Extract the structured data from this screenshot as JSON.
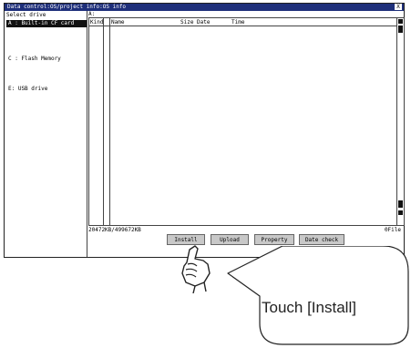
{
  "window": {
    "title": "Data control:OS/project info:OS info",
    "close_glyph": "X"
  },
  "left_panel": {
    "label": "Select drive",
    "drives": [
      {
        "label": "A : Built-in CF card",
        "selected": true
      },
      {
        "label": "C : Flash Memory",
        "selected": false
      },
      {
        "label": "E: USB drive",
        "selected": false
      }
    ]
  },
  "file_list": {
    "path": "A:",
    "columns": [
      "Kind",
      "Name",
      "Size",
      "Date",
      "Time"
    ],
    "rows": []
  },
  "status": {
    "capacity": "20472KB/499672KB",
    "file_count": "0File"
  },
  "buttons": {
    "install": "Install",
    "upload": "Upload",
    "property": "Property",
    "date_check": "Date check"
  },
  "callout": {
    "text": "Touch [Install]"
  },
  "colors": {
    "titlebar": "#1e2f7a",
    "selected_drive": "#111111",
    "button": "#c8c8c8"
  }
}
